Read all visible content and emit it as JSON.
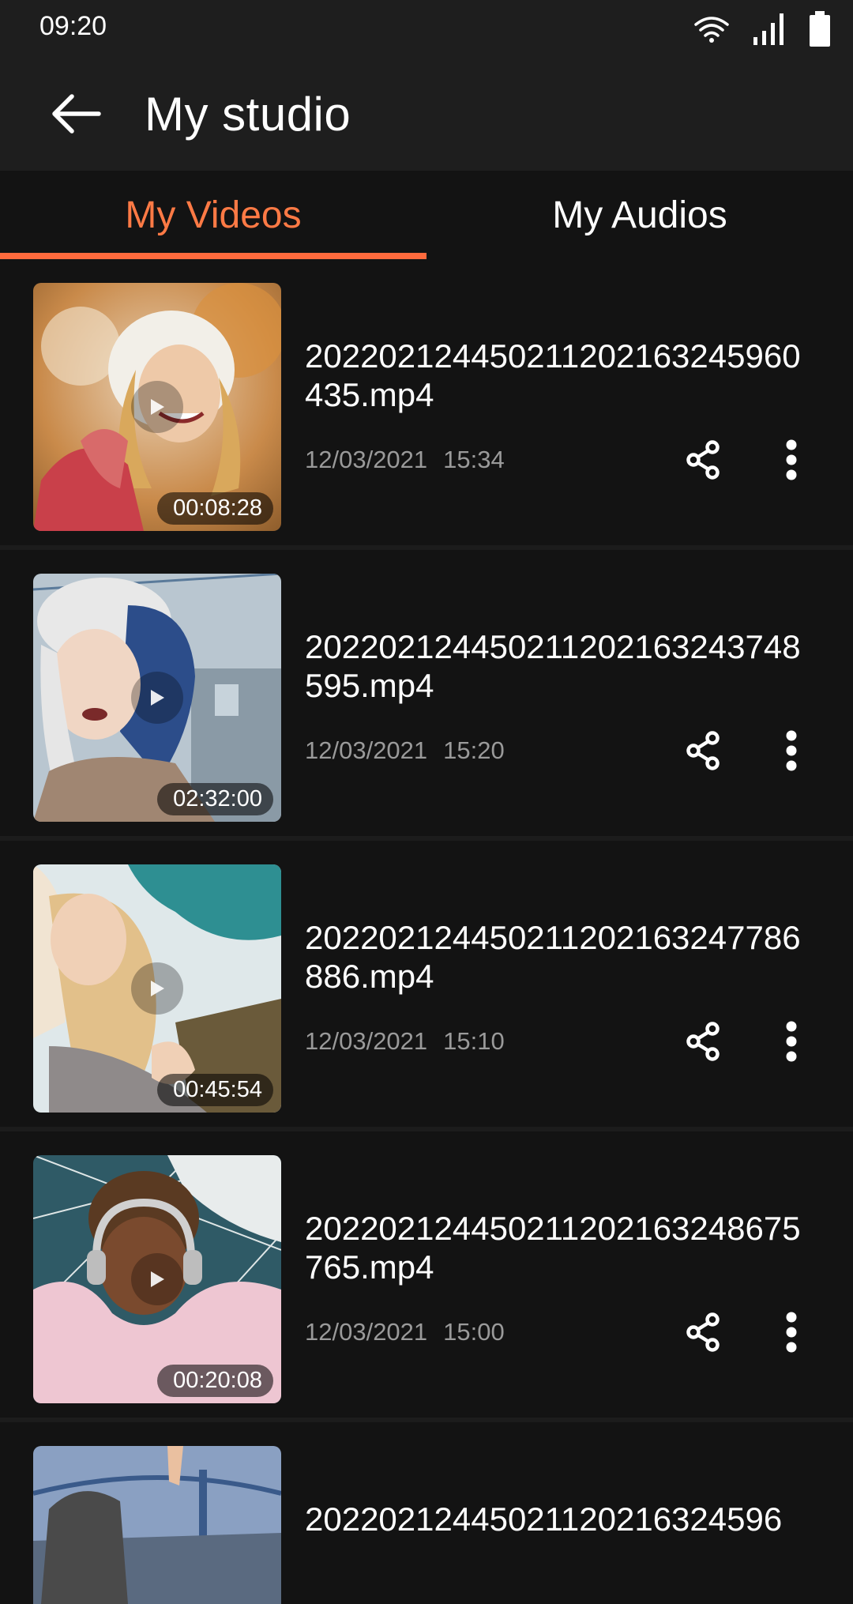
{
  "status_bar": {
    "time": "09:20"
  },
  "app_bar": {
    "title": "My studio"
  },
  "tabs": [
    {
      "label": "My Videos",
      "active": true
    },
    {
      "label": "My Audios",
      "active": false
    }
  ],
  "colors": {
    "accent": "#ff6a3d",
    "background": "#131313",
    "bar": "#1e1e1e",
    "meta_text": "#9a9a9a"
  },
  "videos": [
    {
      "title": "202202124450211202163245960435.mp4",
      "date": "12/03/2021",
      "time": "15:34",
      "duration": "00:08:28"
    },
    {
      "title": "202202124450211202163243748595.mp4",
      "date": "12/03/2021",
      "time": "15:20",
      "duration": "02:32:00"
    },
    {
      "title": "202202124450211202163247786886.mp4",
      "date": "12/03/2021",
      "time": "15:10",
      "duration": "00:45:54"
    },
    {
      "title": "202202124450211202163248675765.mp4",
      "date": "12/03/2021",
      "time": "15:00",
      "duration": "00:20:08"
    },
    {
      "title": "20220212445021120216324596"
    }
  ],
  "icons": {
    "back": "arrow-left-icon",
    "share": "share-icon",
    "more": "more-vertical-icon",
    "play": "play-icon",
    "wifi": "wifi-icon",
    "signal": "signal-icon",
    "battery": "battery-icon"
  }
}
